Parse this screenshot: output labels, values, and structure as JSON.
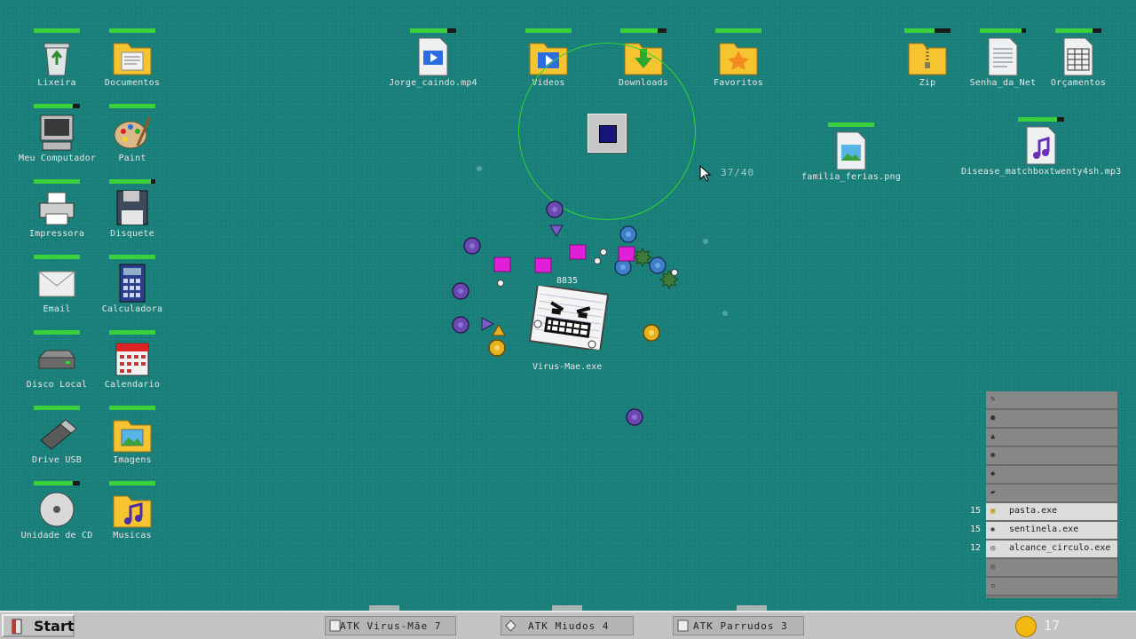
{
  "desktop": {
    "icons": [
      {
        "name": "Lixeira",
        "icon": "recycle-bin-icon",
        "health": 1.0
      },
      {
        "name": "Documentos",
        "icon": "documents-folder-icon",
        "health": 1.0
      },
      {
        "name": "Meu Computador",
        "icon": "computer-icon",
        "health": 0.85
      },
      {
        "name": "Paint",
        "icon": "paint-palette-icon",
        "health": 1.0
      },
      {
        "name": "Impressora",
        "icon": "printer-icon",
        "health": 1.0
      },
      {
        "name": "Disquete",
        "icon": "floppy-disk-icon",
        "health": 0.9
      },
      {
        "name": "Email",
        "icon": "email-envelope-icon",
        "health": 1.0
      },
      {
        "name": "Calculadora",
        "icon": "calculator-icon",
        "health": 1.0
      },
      {
        "name": "Disco Local",
        "icon": "hard-drive-icon",
        "health": 1.0
      },
      {
        "name": "Calendario",
        "icon": "calendar-icon",
        "health": 1.0
      },
      {
        "name": "Drive USB",
        "icon": "usb-drive-icon",
        "health": 1.0
      },
      {
        "name": "Imagens",
        "icon": "images-folder-icon",
        "health": 1.0
      },
      {
        "name": "Unidade de CD",
        "icon": "cd-drive-icon",
        "health": 0.85
      },
      {
        "name": "Musicas",
        "icon": "music-folder-icon",
        "health": 1.0
      },
      {
        "name": "Jorge_caindo.mp4",
        "icon": "video-file-icon",
        "health": 0.8
      },
      {
        "name": "Videos",
        "icon": "videos-folder-icon",
        "health": 1.0
      },
      {
        "name": "Downloads",
        "icon": "downloads-folder-icon",
        "health": 0.8
      },
      {
        "name": "Favoritos",
        "icon": "favorites-folder-icon",
        "health": 1.0
      },
      {
        "name": "Zip",
        "icon": "zip-folder-icon",
        "health": 0.65
      },
      {
        "name": "Senha_da_Net",
        "icon": "text-file-icon",
        "health": 0.9
      },
      {
        "name": "Orçamentos",
        "icon": "spreadsheet-file-icon",
        "health": 0.8
      },
      {
        "name": "familia_ferias.png",
        "icon": "image-file-icon",
        "health": 1.0
      },
      {
        "name": "Disease_matchboxtwenty4sh.mp3",
        "icon": "music-file-icon",
        "health": 0.85
      }
    ]
  },
  "game": {
    "wave_counter": "37/40",
    "boss": {
      "name": "Virus-Mae.exe",
      "hp": "8835"
    }
  },
  "shop": {
    "slots": [
      {
        "icon": "pencil-icon",
        "name": "",
        "cost": "",
        "unlocked": false
      },
      {
        "icon": "bomb-icon",
        "name": "",
        "cost": "",
        "unlocked": false
      },
      {
        "icon": "flask-icon",
        "name": "",
        "cost": "",
        "unlocked": false
      },
      {
        "icon": "globe-icon",
        "name": "",
        "cost": "",
        "unlocked": false
      },
      {
        "icon": "shield-icon",
        "name": "",
        "cost": "",
        "unlocked": false
      },
      {
        "icon": "car-icon",
        "name": "",
        "cost": "",
        "unlocked": false
      },
      {
        "icon": "folder-icon",
        "name": "pasta.exe",
        "cost": "15",
        "unlocked": true
      },
      {
        "icon": "sentinel-icon",
        "name": "sentinela.exe",
        "cost": "15",
        "unlocked": true
      },
      {
        "icon": "range-icon",
        "name": "alcance_circulo.exe",
        "cost": "12",
        "unlocked": true
      },
      {
        "icon": "target-icon",
        "name": "",
        "cost": "",
        "unlocked": false
      },
      {
        "icon": "square-icon",
        "name": "",
        "cost": "",
        "unlocked": false
      }
    ]
  },
  "taskbar": {
    "start_label": "Start",
    "tasks": [
      {
        "label": "ATK Virus-Mãe 7",
        "icon": "document-icon"
      },
      {
        "label": "ATK Miudos 4",
        "icon": "diamond-icon"
      },
      {
        "label": "ATK Parrudos 3",
        "icon": "block-icon"
      }
    ],
    "coins": "17"
  },
  "colors": {
    "desktop": "#177e79",
    "health": "#3bd13b",
    "range": "#31d631",
    "coin": "#f3b712"
  }
}
